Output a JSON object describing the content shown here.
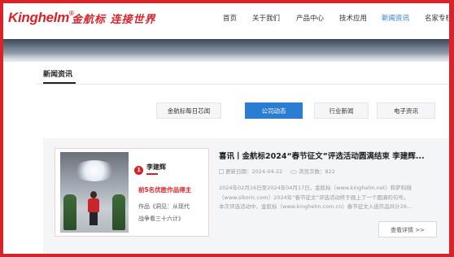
{
  "brand": {
    "logo_en": "Kinghelm",
    "logo_reg": "®",
    "logo_cn": "金航标 连接世界"
  },
  "nav": {
    "items": [
      "首页",
      "关于我们",
      "产品中心",
      "技术应用",
      "新闻资讯",
      "名家专栏"
    ],
    "active": "新闻资讯"
  },
  "section": {
    "title": "新闻资讯"
  },
  "tabs": [
    {
      "label": "金航标每日芯闻",
      "active": false
    },
    {
      "label": "公司动态",
      "active": true
    },
    {
      "label": "行业新闻",
      "active": false
    },
    {
      "label": "电子资讯",
      "active": false
    }
  ],
  "article": {
    "title": "喜讯丨金航标2024“春节征文”评选活动圆满结束 李建辉...",
    "update_label": "更新日期：",
    "update_date": "2024-04-22",
    "views_label": "浏览次数：",
    "views": "822",
    "summary_lines": [
      "2024年02月16日至2024年04月17日，金航标（www.kinghelm.net）和萨科微",
      "（www.slkoric.com）2024年“春节征文”评选活动终于画上了一个圆满的句号。",
      "本次评选活动中，金航标（www.kinghelm.com.cn）春节征文入选作品共计26..."
    ],
    "more_button": "查看详情 >>",
    "thumbnail": {
      "badge": "1",
      "name": "李建辉",
      "award": "前5名优胜作品得主",
      "work_line1": "作品《洞见：从现代",
      "work_line2": "战争看三十六计》"
    }
  },
  "colors": {
    "brand_red": "#d8232a",
    "accent_blue": "#2b7cd3"
  }
}
